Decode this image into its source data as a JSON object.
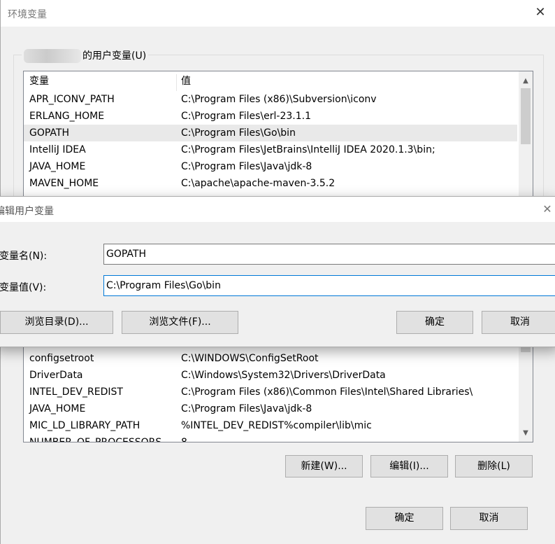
{
  "env_dialog": {
    "title": "环境变量",
    "user_group_label": "的用户变量(U)",
    "user_table": {
      "headers": [
        "变量",
        "值"
      ],
      "rows": [
        {
          "name": "APR_ICONV_PATH",
          "value": "C:\\Program Files (x86)\\Subversion\\iconv"
        },
        {
          "name": "ERLANG_HOME",
          "value": "C:\\Program Files\\erl-23.1.1"
        },
        {
          "name": "GOPATH",
          "value": "C:\\Program Files\\Go\\bin"
        },
        {
          "name": "IntelliJ IDEA",
          "value": "C:\\Program Files\\JetBrains\\IntelliJ IDEA 2020.1.3\\bin;"
        },
        {
          "name": "JAVA_HOME",
          "value": "C:\\Program Files\\Java\\jdk-8"
        },
        {
          "name": "MAVEN_HOME",
          "value": "C:\\apache\\apache-maven-3.5.2"
        }
      ]
    },
    "system_table": {
      "rows": [
        {
          "name": "configsetroot",
          "value": "C:\\WINDOWS\\ConfigSetRoot"
        },
        {
          "name": "DriverData",
          "value": "C:\\Windows\\System32\\Drivers\\DriverData"
        },
        {
          "name": "INTEL_DEV_REDIST",
          "value": "C:\\Program Files (x86)\\Common Files\\Intel\\Shared Libraries\\"
        },
        {
          "name": "JAVA_HOME",
          "value": "C:\\Program Files\\Java\\jdk-8"
        },
        {
          "name": "MIC_LD_LIBRARY_PATH",
          "value": "%INTEL_DEV_REDIST%compiler\\lib\\mic"
        },
        {
          "name": "NUMBER_OF_PROCESSORS",
          "value": "8"
        }
      ]
    },
    "system_buttons": {
      "new": "新建(W)...",
      "edit": "编辑(I)...",
      "delete": "删除(L)"
    },
    "ok": "确定",
    "cancel": "取消"
  },
  "edit_dialog": {
    "title": "编辑用户变量",
    "name_label": "变量名(N):",
    "value_label": "变量值(V):",
    "name_value": "GOPATH",
    "value_value": "C:\\Program Files\\Go\\bin",
    "browse_dir": "浏览目录(D)...",
    "browse_file": "浏览文件(F)...",
    "ok": "确定",
    "cancel": "取消"
  },
  "colors": {
    "focus_border": "#0078d7",
    "selected_row": "#e9e9e9"
  }
}
